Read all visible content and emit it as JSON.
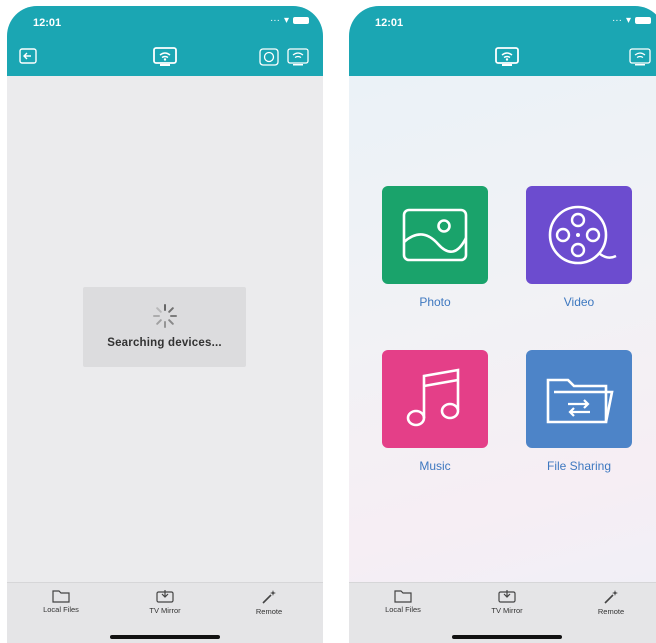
{
  "status": {
    "time": "12:01"
  },
  "left_screen": {
    "search_text": "Searching devices..."
  },
  "right_screen": {
    "tiles": [
      {
        "label": "Photo",
        "color": "#1aa36b",
        "icon": "image-icon"
      },
      {
        "label": "Video",
        "color": "#6c4ccf",
        "icon": "film-reel-icon"
      },
      {
        "label": "Music",
        "color": "#e43f88",
        "icon": "music-note-icon"
      },
      {
        "label": "File Sharing",
        "color": "#4d84c8",
        "icon": "folder-sync-icon"
      }
    ]
  },
  "tabbar": {
    "local_files": "Local Files",
    "tv_mirror": "TV Mirror",
    "remote": "Remote"
  },
  "colors": {
    "header": "#1ba6b3",
    "tile_label": "#3e78c0"
  }
}
